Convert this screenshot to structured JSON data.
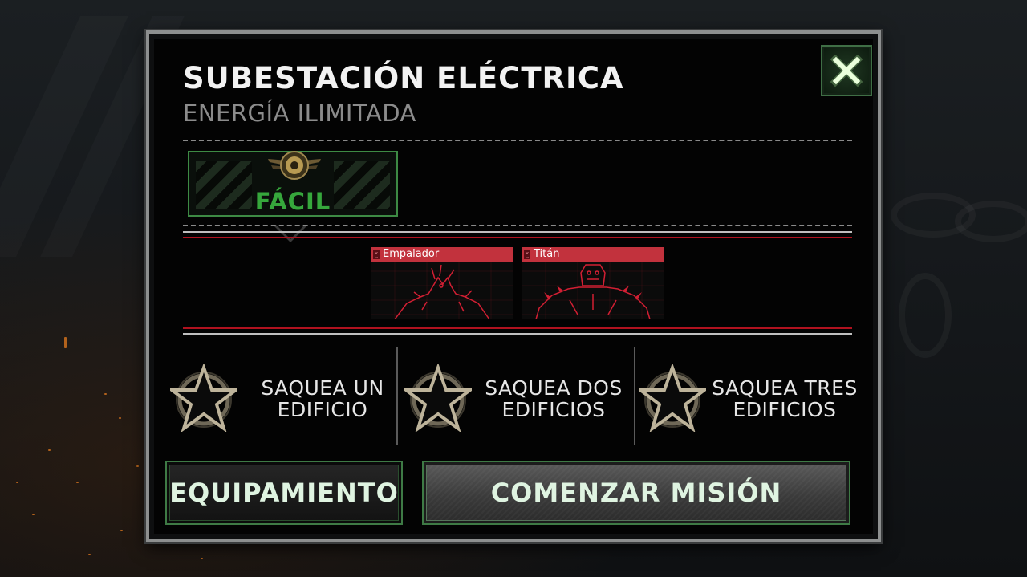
{
  "mission": {
    "title": "SUBESTACIÓN ELÉCTRICA",
    "subtitle": "ENERGÍA ILIMITADA"
  },
  "close": {
    "icon": "close-x-icon",
    "color": "#e8ffd9"
  },
  "difficulty": {
    "label": "FÁCIL",
    "color": "#36a73c",
    "icon": "medal-icon"
  },
  "enemies": [
    {
      "name": "Empalador",
      "icon": "empalador-portrait"
    },
    {
      "name": "Titán",
      "icon": "titan-portrait"
    }
  ],
  "enemy_accent": "#c2323d",
  "objectives": [
    {
      "label_line1": "SAQUEA UN",
      "label_line2": "EDIFICIO",
      "icon": "star-icon"
    },
    {
      "label_line1": "SAQUEA DOS",
      "label_line2": "EDIFICIOS",
      "icon": "star-icon"
    },
    {
      "label_line1": "SAQUEA TRES",
      "label_line2": "EDIFICIOS",
      "icon": "star-icon"
    }
  ],
  "buttons": {
    "equipment_label": "EQUIPAMIENTO",
    "start_label": "COMENZAR MISIÓN"
  }
}
